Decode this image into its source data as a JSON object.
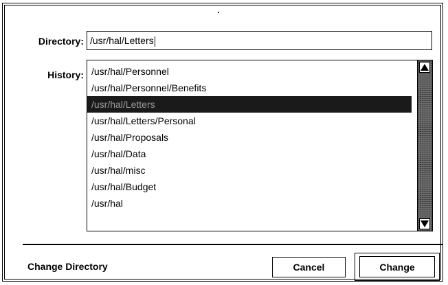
{
  "dialog": {
    "directory_label": "Directory:",
    "directory_value": "/usr/hal/Letters",
    "history_label": "History:",
    "history": [
      {
        "path": "/usr/hal/Personnel",
        "selected": false
      },
      {
        "path": "/usr/hal/Personnel/Benefits",
        "selected": false
      },
      {
        "path": "/usr/hal/Letters",
        "selected": true
      },
      {
        "path": "/usr/hal/Letters/Personal",
        "selected": false
      },
      {
        "path": "/usr/hal/Proposals",
        "selected": false
      },
      {
        "path": "/usr/hal/Data",
        "selected": false
      },
      {
        "path": "/usr/hal/misc",
        "selected": false
      },
      {
        "path": "/usr/hal/Budget",
        "selected": false
      },
      {
        "path": "/usr/hal",
        "selected": false
      }
    ],
    "footer_title": "Change Directory",
    "cancel_label": "Cancel",
    "change_label": "Change",
    "scroll_up_icon": "triangle-up-icon",
    "scroll_down_icon": "triangle-down-icon"
  }
}
